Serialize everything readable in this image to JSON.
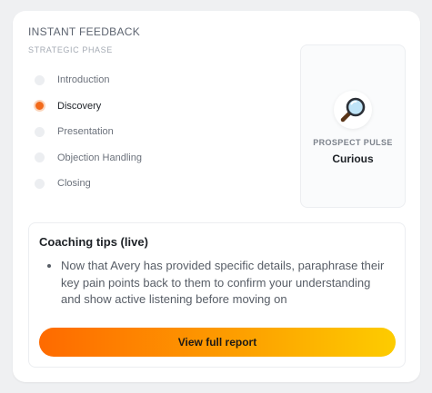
{
  "header": {
    "title": "INSTANT FEEDBACK",
    "subtitle": "STRATEGIC PHASE"
  },
  "phases": [
    {
      "label": "Introduction",
      "active": false
    },
    {
      "label": "Discovery",
      "active": true
    },
    {
      "label": "Presentation",
      "active": false
    },
    {
      "label": "Objection Handling",
      "active": false
    },
    {
      "label": "Closing",
      "active": false
    }
  ],
  "pulse": {
    "icon": "magnifying-glass-icon",
    "label": "PROSPECT PULSE",
    "value": "Curious"
  },
  "coaching": {
    "title": "Coaching tips (live)",
    "tips": [
      "Now that Avery has provided specific details, paraphrase their key pain points back to them to confirm your understanding and show active listening before moving on"
    ],
    "button_label": "View full report"
  },
  "colors": {
    "accent": "#f26a1b",
    "gradient_start": "#fe6a00",
    "gradient_end": "#fdcc00"
  }
}
